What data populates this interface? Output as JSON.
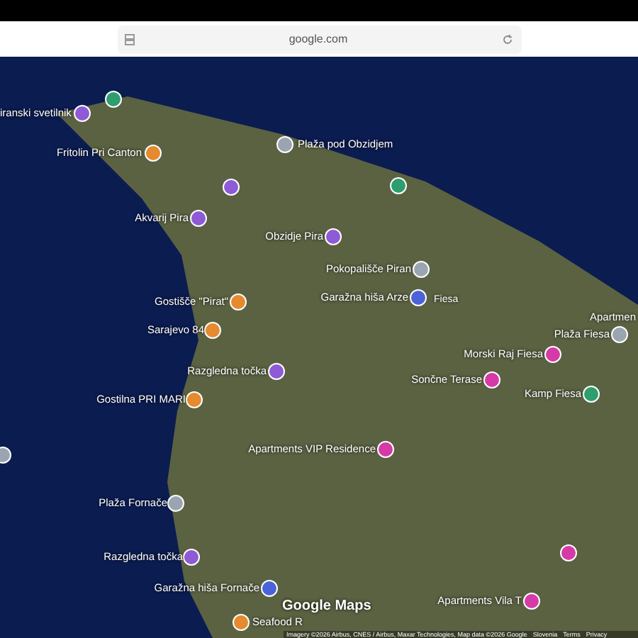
{
  "browser": {
    "address": "google.com"
  },
  "places": [
    {
      "label": "iranski svetilnik",
      "color": "#8e5ad6"
    },
    {
      "color": "#2e9e6e"
    },
    {
      "label": "Fritolin Pri Canton",
      "color": "#e58a2e"
    },
    {
      "label": "Plaža pod Obzidjem",
      "color": "#9aa5b1"
    },
    {
      "color": "#2e9e6e"
    },
    {
      "color": "#8e5ad6"
    },
    {
      "label": "Akvarij Pira",
      "color": "#8e5ad6"
    },
    {
      "label": "Obzidje Pira",
      "color": "#8e5ad6"
    },
    {
      "label": "Pokopališče Piran",
      "color": "#9aa5b1"
    },
    {
      "label": "Garažna hiša Arze",
      "color": "#4a63d8"
    },
    {
      "label": "Gostišče \"Pirat\"",
      "color": "#e58a2e"
    },
    {
      "label": "Sarajevo 84",
      "color": "#e58a2e"
    },
    {
      "label": "Razgledna točka",
      "color": "#8e5ad6"
    },
    {
      "label": "Apartmen"
    },
    {
      "label": "Plaža Fiesa",
      "color": "#9aa5b1"
    },
    {
      "label": "Morski Raj Fiesa",
      "color": "#d63aa6"
    },
    {
      "label": "Sončne Terase",
      "color": "#d63aa6"
    },
    {
      "label": "Kamp Fiesa",
      "color": "#2e9e6e"
    },
    {
      "label": "Gostilna PRI MARI",
      "color": "#e58a2e"
    },
    {
      "label": "Apartments VIP Residence",
      "color": "#d63aa6"
    },
    {
      "color": "#9aa5b1"
    },
    {
      "label": "Plaža Fornače",
      "color": "#9aa5b1"
    },
    {
      "label": "Razgledna točka",
      "color": "#8e5ad6"
    },
    {
      "label": "Garažna hiša Fornače",
      "color": "#4a63d8"
    },
    {
      "label": "Seafood R",
      "color": "#e58a2e"
    },
    {
      "label": "Apartments Vila T",
      "color": "#d63aa6"
    },
    {
      "color": "#d63aa6"
    }
  ],
  "road_labels": [
    "Fiesa"
  ],
  "logo": "Google Maps",
  "attribution": "Imagery ©2026 Airbus, CNES / Airbus, Maxar Technologies, Map data ©2026 Google",
  "footer_links": [
    "Slovenia",
    "Terms",
    "Privacy"
  ]
}
